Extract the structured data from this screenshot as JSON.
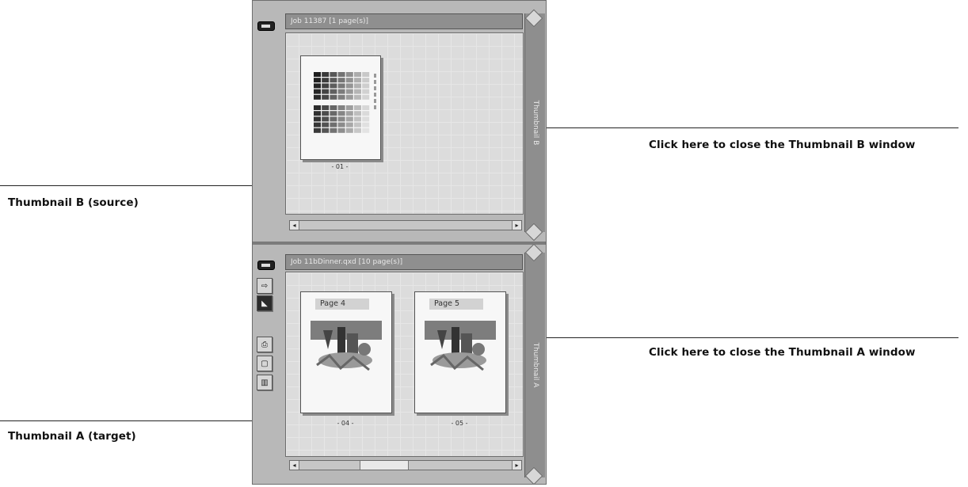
{
  "callouts": {
    "close_b": "Click here to close the Thumbnail B window",
    "close_a": "Click here to close the Thumbnail A window",
    "source_b": "Thumbnail B (source)",
    "target_a": "Thumbnail A (target)"
  },
  "pane_b": {
    "title": "Job 11387 [1 page(s)]",
    "side_tab": "Thumbnail B",
    "pages": [
      {
        "label": "- 01 -"
      }
    ]
  },
  "pane_a": {
    "title": "Job 11bDinner.qxd [10 page(s)]",
    "side_tab": "Thumbnail A",
    "pages": [
      {
        "title": "Page 4",
        "label": "- 04 -"
      },
      {
        "title": "Page 5",
        "label": "- 05 -"
      }
    ]
  },
  "toolbar": {
    "icons": [
      "hand-arrow-icon",
      "select-icon",
      "print-icon",
      "page-icon",
      "trash-icon"
    ]
  },
  "colors": {
    "title_bar": "#8f8f8f",
    "side_tab": "#8e8e8e",
    "content_bg": "#dcdcdc",
    "frame": "#a7a7a7"
  }
}
